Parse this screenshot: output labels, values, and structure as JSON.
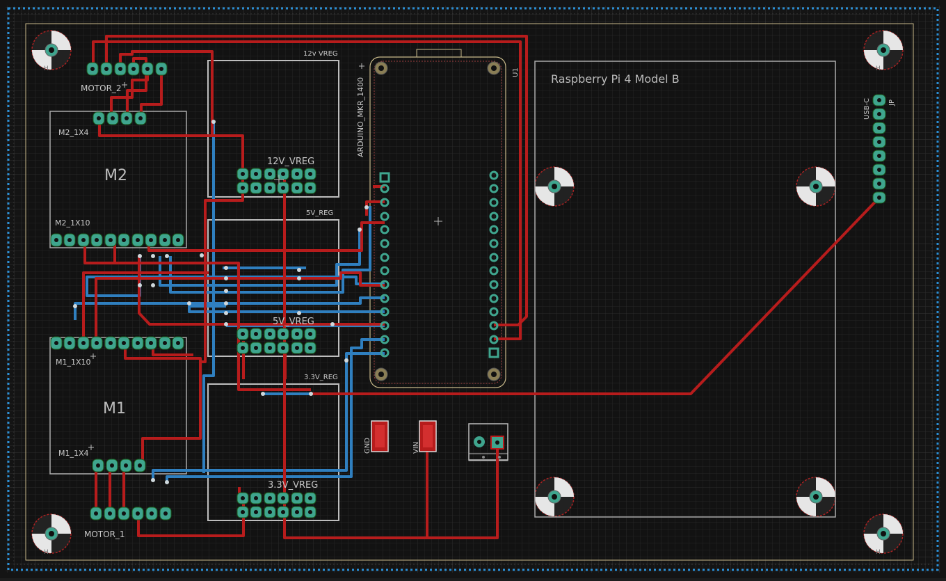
{
  "labels": {
    "reg12_title": "12v VREG",
    "reg12_header": "12V_VREG",
    "reg5_title": "5V_REG",
    "reg5_header": "5V_VREG",
    "reg33_title": "3.3V_REG",
    "reg33_header": "3.3V_VREG",
    "arduino": "ARDUINO_MKR_1400",
    "arduino_ref": "U1",
    "rpi": "Raspberry Pi 4 Model B",
    "motor2": "MOTOR_2",
    "motor1": "MOTOR_1",
    "m2_title": "M2",
    "m2_1x4": "M2_1X4",
    "m2_1x10": "M2_1X10",
    "m1_title": "M1",
    "m1_1x10": "M1_1X10",
    "m1_1x4": "M1_1X4",
    "gnd": "GND",
    "vin": "VIN",
    "usb_c": "USB-C",
    "jp": "JP",
    "hole": "H"
  },
  "colors": {
    "top_copper": "#b71c1c",
    "bottom_copper": "#2f7fbf",
    "pad": "#3fa58e",
    "silkscreen": "#bdbdbd",
    "board_outline": "#c8b98a",
    "keepout": "#2a8fd6"
  }
}
